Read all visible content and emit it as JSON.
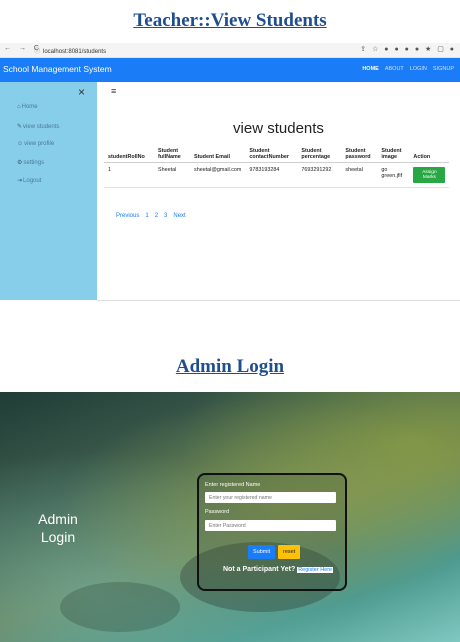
{
  "headings": {
    "top": "Teacher::View Students",
    "bottom": "Admin Login"
  },
  "browser": {
    "nav_icons": "← → C",
    "url_prefix": "ⓘ",
    "url_host": "localhost:8081",
    "url_path": "/students",
    "ext_icons": "⇪ ☆ ● ● ● ● ★ ▢ ●"
  },
  "navbar": {
    "brand": "School Management System",
    "links": [
      "HOME",
      "ABOUT",
      "LOGIN",
      "SIGNUP"
    ]
  },
  "sidebar": {
    "close": "×",
    "items": [
      {
        "icon": "home-icon",
        "glyph": "⌂",
        "label": "Home"
      },
      {
        "icon": "pencil-icon",
        "glyph": "✎",
        "label": "view students"
      },
      {
        "icon": "user-icon",
        "glyph": "☺",
        "label": "view profile"
      },
      {
        "icon": "gears-icon",
        "glyph": "⚙",
        "label": "settings"
      },
      {
        "icon": "logout-icon",
        "glyph": "⇥",
        "label": "Logout"
      }
    ]
  },
  "main": {
    "hamburger": "≡",
    "title": "view students",
    "columns": [
      "studentRollNo",
      "Student fullName",
      "Student Email",
      "Student contactNumber",
      "Student percentage",
      "Student password",
      "Student image",
      "Action"
    ],
    "rows": [
      {
        "roll": "1",
        "name": "Sheetal",
        "email": "sheetal@gmail.com",
        "contact": "9783193284",
        "percentage": "7693291292",
        "password": "sheetal",
        "image": "go green.jfif",
        "action": "Assign Marks"
      }
    ],
    "pager": [
      "Previous",
      "1",
      "2",
      "3",
      "Next"
    ]
  },
  "login": {
    "title_line1": "Admin",
    "title_line2": "Login",
    "name_label": "Enter registered Name",
    "name_placeholder": "Enter your registered name",
    "password_label": "Password",
    "password_placeholder": "Enter Password",
    "submit": "Submit",
    "reset": "reset",
    "not_participant": "Not a Participant Yet?",
    "register_link": "Register Here"
  },
  "colors": {
    "primary": "#1a7cf7",
    "sidebar": "#87ceeb",
    "success": "#28a745",
    "warning": "#ffc107",
    "heading": "#1f4e8f"
  }
}
